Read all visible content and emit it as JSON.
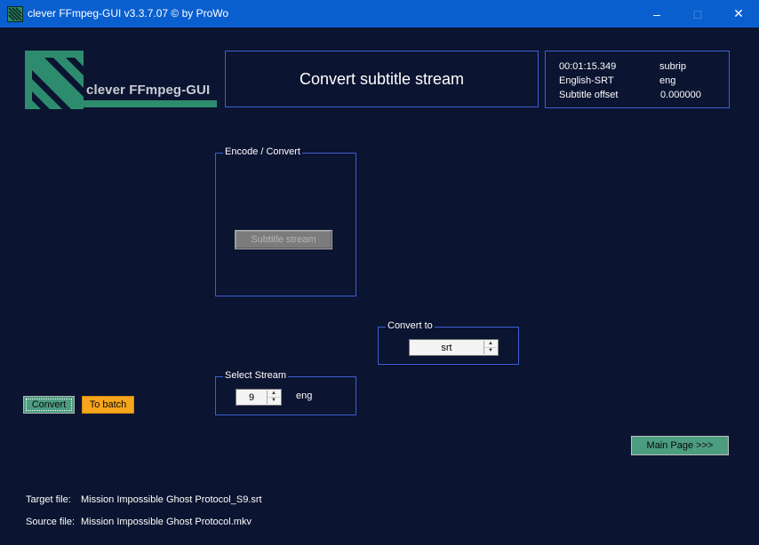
{
  "window": {
    "title": "clever FFmpeg-GUI v3.3.7.07   © by ProWo",
    "min_icon": "minimize-icon",
    "max_icon": "maximize-icon",
    "close_icon": "close-icon"
  },
  "logo": {
    "text": "clever FFmpeg-GUI"
  },
  "header": {
    "title": "Convert subtitle stream"
  },
  "info": {
    "duration": "00:01:15.349",
    "codec": "subrip",
    "track_name": "English-SRT",
    "language": "eng",
    "offset_label": "Subtitle offset",
    "offset_value": "0.000000"
  },
  "encode_group": {
    "label": "Encode / Convert",
    "subtitle_button": "Subtitle stream"
  },
  "convert_to_group": {
    "label": "Convert to",
    "value": "srt"
  },
  "select_stream_group": {
    "label": "Select Stream",
    "value": "9",
    "language": "eng"
  },
  "actions": {
    "convert": "Convert",
    "to_batch": "To batch",
    "main_page": "Main Page >>>"
  },
  "files": {
    "target_label": "Target file:",
    "target_value": "Mission Impossible Ghost Protocol_S9.srt",
    "source_label": "Source file:",
    "source_value": "Mission Impossible Ghost Protocol.mkv"
  },
  "colors": {
    "background": "#0b1430",
    "titlebar": "#0a5fcf",
    "border": "#3f5fd6",
    "green_button": "#4c9c80",
    "orange_button": "#f7a51c"
  }
}
